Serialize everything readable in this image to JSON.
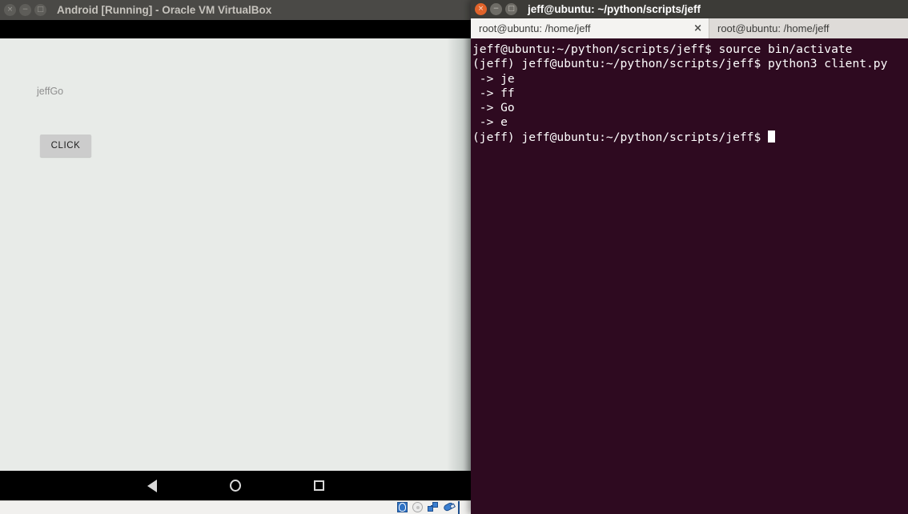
{
  "vbox_window": {
    "title": "Android [Running] - Oracle VM VirtualBox",
    "controls": [
      {
        "name": "close",
        "glyph": "×"
      },
      {
        "name": "minimize",
        "glyph": "−"
      },
      {
        "name": "maximize",
        "glyph": "□"
      }
    ],
    "android_app": {
      "label": "jeffGo",
      "button_label": "CLICK",
      "background_color": "#e8ebe8",
      "button_color": "#cccccc",
      "label_color": "#8f8f8f"
    },
    "navbar": {
      "back": "back-triangle",
      "home": "home-circle",
      "recents": "recents-square"
    },
    "statusbar": {
      "icons": [
        "hard-disk-icon",
        "optical-disk-icon",
        "network-icon",
        "usb-icon",
        "shared-folder-icon"
      ]
    }
  },
  "terminal_window": {
    "title": "jeff@ubuntu: ~/python/scripts/jeff",
    "controls": [
      {
        "name": "close",
        "glyph": "×"
      },
      {
        "name": "minimize",
        "glyph": "−"
      },
      {
        "name": "maximize",
        "glyph": "□"
      }
    ],
    "tabs": [
      {
        "label": "root@ubuntu: /home/jeff",
        "selected": true,
        "close_glyph": "×"
      },
      {
        "label": "root@ubuntu: /home/jeff",
        "selected": false
      }
    ],
    "background_color": "#2e0a20",
    "text_color": "#ffffff",
    "lines": [
      "jeff@ubuntu:~/python/scripts/jeff$ source bin/activate",
      "(jeff) jeff@ubuntu:~/python/scripts/jeff$ python3 client.py",
      " -> je",
      " -> ff",
      " -> Go",
      " -> e"
    ],
    "prompt_line": "(jeff) jeff@ubuntu:~/python/scripts/jeff$ ",
    "cursor": "block"
  }
}
